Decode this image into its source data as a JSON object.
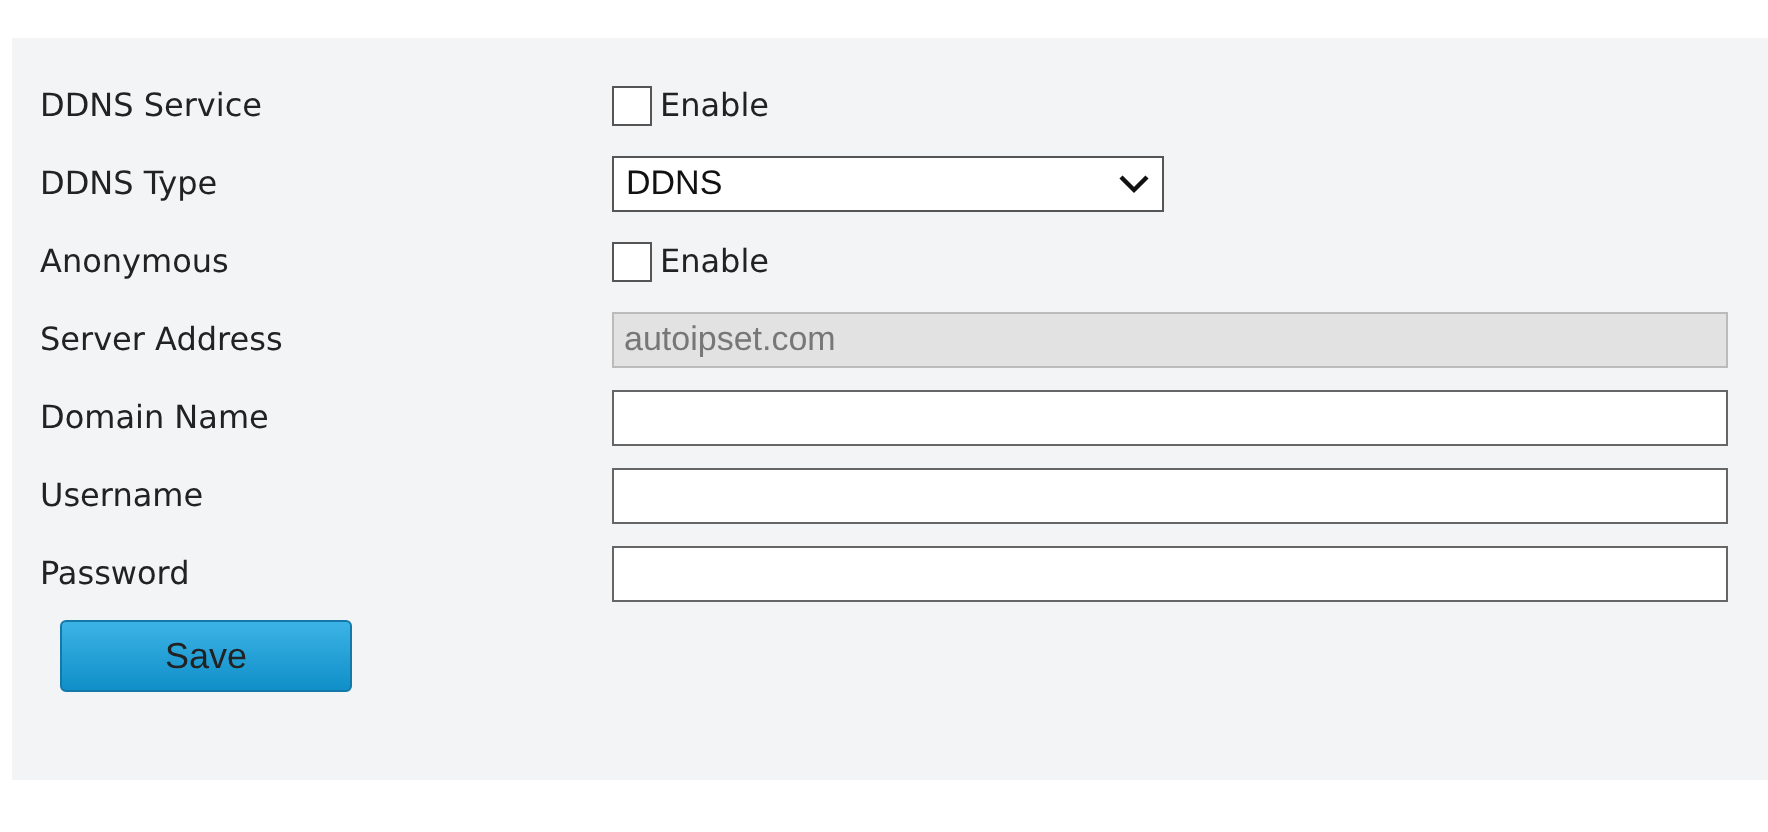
{
  "fields": [
    {
      "label": "DDNS Service",
      "kind": "checkbox",
      "checked": false,
      "text": "Enable"
    },
    {
      "label": "DDNS Type",
      "kind": "select",
      "value": "DDNS"
    },
    {
      "label": "Anonymous",
      "kind": "checkbox",
      "checked": false,
      "text": "Enable"
    },
    {
      "label": "Server Address",
      "kind": "text",
      "value": "autoipset.com",
      "disabled": true
    },
    {
      "label": "Domain Name",
      "kind": "text",
      "disabled": false
    },
    {
      "label": "Username",
      "kind": "text",
      "disabled": false
    },
    {
      "label": "Password",
      "kind": "text",
      "disabled": false
    }
  ],
  "buttons": [
    "Save"
  ]
}
